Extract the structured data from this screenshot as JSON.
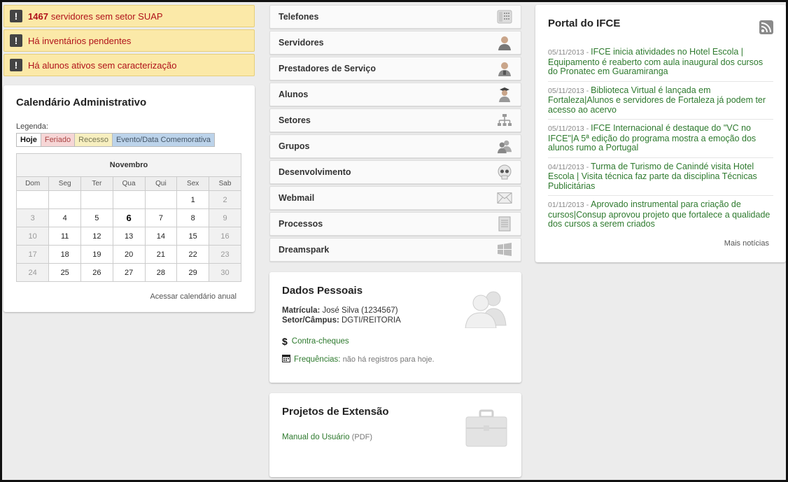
{
  "alerts": [
    {
      "count": "1467",
      "text": "servidores sem setor SUAP"
    },
    {
      "count": "",
      "text": "Há inventários pendentes"
    },
    {
      "count": "",
      "text": "Há alunos ativos sem caracterização"
    }
  ],
  "calendar": {
    "title": "Calendário Administrativo",
    "legend_title": "Legenda:",
    "legend": [
      "Hoje",
      "Feriado",
      "Recesso",
      "Evento/Data Comemorativa"
    ],
    "month": "Novembro",
    "days": [
      "Dom",
      "Seg",
      "Ter",
      "Qua",
      "Qui",
      "Sex",
      "Sab"
    ],
    "weeks": [
      [
        "",
        "",
        "",
        "",
        "",
        "1",
        "2"
      ],
      [
        "3",
        "4",
        "5",
        "6",
        "7",
        "8",
        "9"
      ],
      [
        "10",
        "11",
        "12",
        "13",
        "14",
        "15",
        "16"
      ],
      [
        "17",
        "18",
        "19",
        "20",
        "21",
        "22",
        "23"
      ],
      [
        "24",
        "25",
        "26",
        "27",
        "28",
        "29",
        "30"
      ]
    ],
    "today": "6",
    "link": "Acessar calendário anual"
  },
  "menu": [
    {
      "label": "Telefones",
      "icon": "phone-icon"
    },
    {
      "label": "Servidores",
      "icon": "user-icon"
    },
    {
      "label": "Prestadores de Serviço",
      "icon": "worker-icon"
    },
    {
      "label": "Alunos",
      "icon": "student-icon"
    },
    {
      "label": "Setores",
      "icon": "org-chart-icon"
    },
    {
      "label": "Grupos",
      "icon": "group-icon"
    },
    {
      "label": "Desenvolvimento",
      "icon": "skull-icon"
    },
    {
      "label": "Webmail",
      "icon": "mail-icon"
    },
    {
      "label": "Processos",
      "icon": "document-icon"
    },
    {
      "label": "Dreamspark",
      "icon": "windows-icon"
    }
  ],
  "dados": {
    "title": "Dados Pessoais",
    "matricula_label": "Matrícula:",
    "matricula": "José Silva (1234567)",
    "setor_label": "Setor/Câmpus:",
    "setor": "DGTI/REITORIA",
    "contra": "Contra-cheques",
    "freq_label": "Frequências:",
    "freq_text": "não há registros para hoje."
  },
  "projetos": {
    "title": "Projetos de Extensão",
    "link": "Manual do Usuário",
    "suffix": "(PDF)"
  },
  "portal": {
    "title": "Portal do IFCE",
    "news": [
      {
        "date": "05/11/2013",
        "text": "IFCE inicia atividades no Hotel Escola | Equipamento é reaberto com aula inaugural dos cursos do Pronatec em Guaramiranga"
      },
      {
        "date": "05/11/2013",
        "text": "Biblioteca Virtual é lançada em Fortaleza|Alunos e servidores de Fortaleza já podem ter acesso ao acervo"
      },
      {
        "date": "05/11/2013",
        "text": "IFCE Internacional é destaque do \"VC no IFCE\"|A 5ª edição do programa mostra a emoção dos alunos rumo a Portugal"
      },
      {
        "date": "04/11/2013",
        "text": "Turma de Turismo de Canindé visita Hotel Escola | Visita técnica faz parte da disciplina Técnicas Publicitárias"
      },
      {
        "date": "01/11/2013",
        "text": "Aprovado instrumental para criação de cursos|Consup aprovou projeto que fortalece a qualidade dos cursos a serem criados"
      }
    ],
    "more": "Mais notícias"
  }
}
